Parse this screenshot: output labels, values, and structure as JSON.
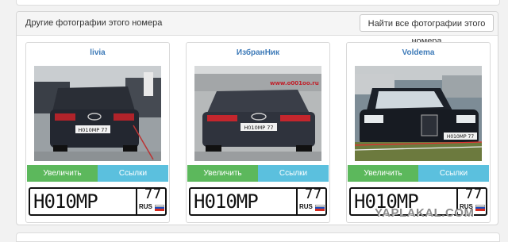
{
  "panel": {
    "title": "Другие фотографии этого номера",
    "find_all_button": "Найти все фотографии этого номера"
  },
  "cards": [
    {
      "username": "livia",
      "photo_caption": "",
      "photo_plate": "Н010МР 77",
      "enlarge_label": "Увеличить",
      "links_label": "Ссылки",
      "plate": {
        "number": "Н010МР",
        "region": "77",
        "country": "RUS"
      }
    },
    {
      "username": "ИзбранНик",
      "photo_caption": "www.o001oo.ru",
      "photo_plate": "Н010МР 77",
      "enlarge_label": "Увеличить",
      "links_label": "Ссылки",
      "plate": {
        "number": "Н010МР",
        "region": "77",
        "country": "RUS"
      }
    },
    {
      "username": "Voldema",
      "photo_caption": "",
      "photo_plate": "Н010МР 77",
      "enlarge_label": "Увеличить",
      "links_label": "Ссылки",
      "plate": {
        "number": "Н010МР",
        "region": "77",
        "country": "RUS"
      }
    }
  ],
  "watermark": "YAPLAKAL.COM",
  "colors": {
    "link": "#3d7ab8",
    "enlarge_button": "#5cb85c",
    "links_button": "#5bc0de",
    "flag": [
      "#ffffff",
      "#1c4fbf",
      "#d52b1e"
    ]
  }
}
